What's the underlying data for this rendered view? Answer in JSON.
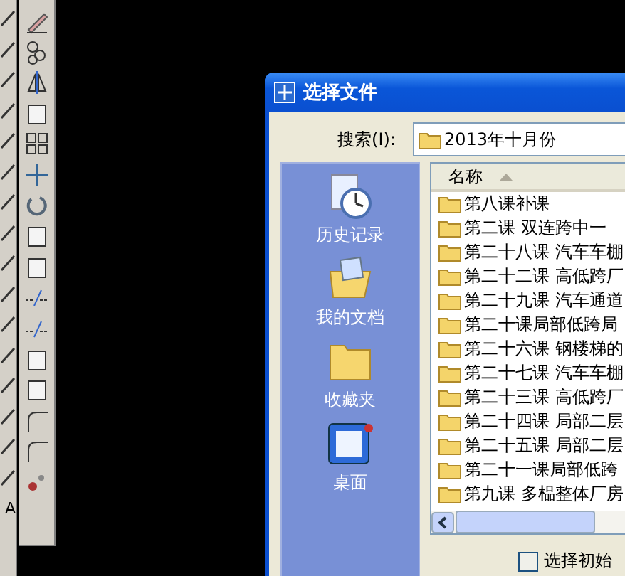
{
  "toolbar_left": {
    "last_tool": "A"
  },
  "dialog": {
    "title": "选择文件",
    "search": {
      "label": "搜索(I):",
      "value": "2013年十月份"
    },
    "places": [
      {
        "label": "历史记录",
        "kind": "history",
        "selected": false
      },
      {
        "label": "我的文档",
        "kind": "documents",
        "selected": false
      },
      {
        "label": "收藏夹",
        "kind": "favorites",
        "selected": false
      },
      {
        "label": "桌面",
        "kind": "desktop",
        "selected": false
      }
    ],
    "file_list": {
      "columns": [
        "名称"
      ],
      "rows": [
        {
          "name": "第八课补课",
          "selected": false
        },
        {
          "name": "第二课 双连跨中一",
          "selected": false
        },
        {
          "name": "第二十八课 汽车车棚",
          "selected": false
        },
        {
          "name": "第二十二课 高低跨厂",
          "selected": false
        },
        {
          "name": "第二十九课 汽车通道",
          "selected": false
        },
        {
          "name": "第二十课局部低跨局",
          "selected": false
        },
        {
          "name": "第二十六课 钢楼梯的",
          "selected": false
        },
        {
          "name": "第二十七课 汽车车棚",
          "selected": false
        },
        {
          "name": "第二十三课 高低跨厂",
          "selected": false
        },
        {
          "name": "第二十四课 局部二层",
          "selected": false
        },
        {
          "name": "第二十五课 局部二层",
          "selected": false
        },
        {
          "name": "第二十一课局部低跨",
          "selected": false
        },
        {
          "name": "第九课 多榀整体厂房",
          "selected": false
        }
      ]
    },
    "initial_view": {
      "label": "选择初始",
      "checked": false
    }
  }
}
